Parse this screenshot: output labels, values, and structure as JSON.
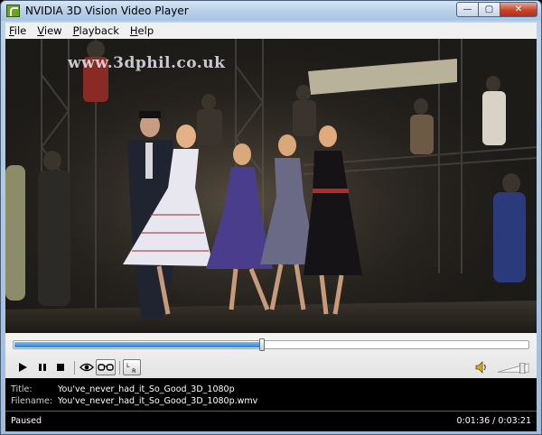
{
  "window": {
    "title": "NVIDIA 3D Vision Video Player",
    "minimize_glyph": "—",
    "maximize_glyph": "▢",
    "close_glyph": "✕"
  },
  "menu": {
    "items": [
      {
        "label": "File",
        "accel": "F",
        "rest": "ile"
      },
      {
        "label": "View",
        "accel": "V",
        "rest": "iew"
      },
      {
        "label": "Playback",
        "accel": "P",
        "rest": "layback"
      },
      {
        "label": "Help",
        "accel": "H",
        "rest": "elp"
      }
    ]
  },
  "video": {
    "watermark": "www.3dphil.co.uk"
  },
  "playback": {
    "progress": 0.4845,
    "volume": 0.85
  },
  "icons": {
    "play": "play-icon",
    "pause": "pause-icon",
    "stop": "stop-icon",
    "eye": "eye-icon",
    "glasses": "3d-glasses-icon",
    "lr": "left-right-eye-icon",
    "volume": "speaker-icon"
  },
  "info": {
    "title_label": "Title:",
    "title_value": "You've_never_had_it_So_Good_3D_1080p",
    "filename_label": "Filename:",
    "filename_value": "You've_never_had_it_So_Good_3D_1080p.wmv",
    "status": "Paused",
    "time": "0:01:36 / 0:03:21"
  }
}
